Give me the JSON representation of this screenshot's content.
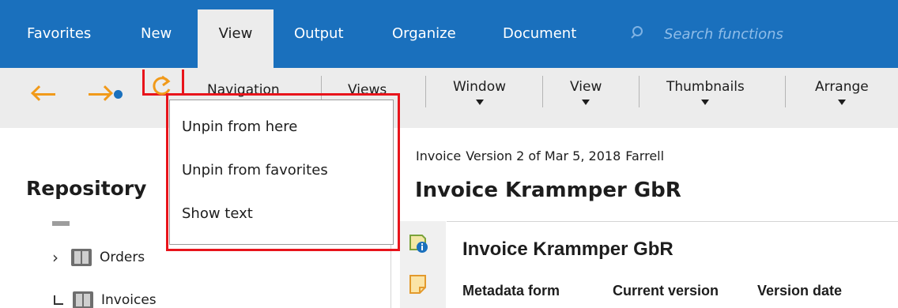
{
  "ribbon": {
    "tabs": [
      {
        "label": "Favorites"
      },
      {
        "label": "New"
      },
      {
        "label": "View"
      },
      {
        "label": "Output"
      },
      {
        "label": "Organize"
      },
      {
        "label": "Document"
      }
    ],
    "active_tab": "View",
    "search": {
      "placeholder": "Search functions",
      "value": ""
    }
  },
  "toolbar": {
    "icons": [
      "back-arrow",
      "forward-arrow",
      "refresh"
    ],
    "buttons": [
      {
        "label": "Navigation",
        "has_dropdown": false
      },
      {
        "label": "Views",
        "has_dropdown": false
      },
      {
        "label": "Window",
        "has_dropdown": true
      },
      {
        "label": "View",
        "has_dropdown": true
      },
      {
        "label": "Thumbnails",
        "has_dropdown": true
      },
      {
        "label": "Arrange",
        "has_dropdown": true
      }
    ]
  },
  "context_menu": {
    "items": [
      {
        "label": "Unpin from here"
      },
      {
        "label": "Unpin from favorites"
      },
      {
        "label": "Show text"
      }
    ]
  },
  "left_panel": {
    "title": "Repository",
    "tree": [
      {
        "label": "Orders",
        "icon": "folder-icon",
        "expander": "chevron-right"
      },
      {
        "label": "Invoices",
        "icon": "folder-icon",
        "expander": "tree-corner"
      }
    ]
  },
  "document": {
    "meta": {
      "type": "Invoice",
      "version": "Version 2 of Mar 5, 2018",
      "author": "Farrell"
    },
    "title": "Invoice Krammper GbR",
    "card": {
      "title": "Invoice Krammper GbR",
      "columns": [
        "Metadata form",
        "Current version",
        "Version date"
      ]
    }
  },
  "colors": {
    "ribbon_blue": "#1a70bd",
    "toolbar_gray": "#ececec",
    "accent_orange": "#f19a1a",
    "highlight_red": "#e8141b"
  }
}
